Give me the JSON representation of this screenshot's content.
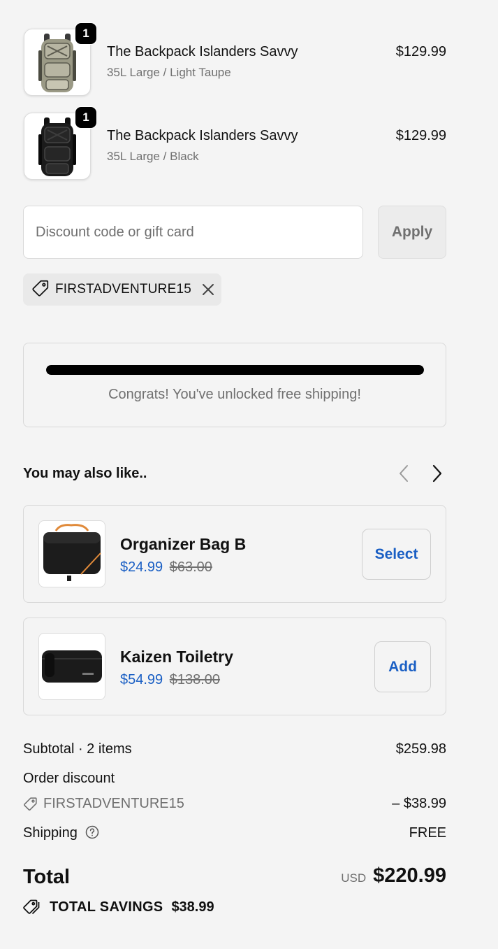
{
  "line_items": [
    {
      "quantity": "1",
      "title": "The Backpack Islanders Savvy",
      "variant": "35L Large / Light Taupe",
      "price": "$129.99"
    },
    {
      "quantity": "1",
      "title": "The Backpack Islanders Savvy",
      "variant": "35L Large / Black",
      "price": "$129.99"
    }
  ],
  "discount": {
    "placeholder": "Discount code or gift card",
    "apply_label": "Apply",
    "applied_code": "FIRSTADVENTURE15"
  },
  "shipping_bar": {
    "progress": 1.0,
    "message": "Congrats! You've unlocked free shipping!"
  },
  "recommendations": {
    "title": "You may also like..",
    "items": [
      {
        "name": "Organizer Bag B",
        "sale_price": "$24.99",
        "compare_price": "$63.00",
        "button_label": "Select"
      },
      {
        "name": "Kaizen Toiletry",
        "sale_price": "$54.99",
        "compare_price": "$138.00",
        "button_label": "Add"
      }
    ]
  },
  "summary": {
    "subtotal_label": "Subtotal · 2 items",
    "subtotal_value": "$259.98",
    "order_discount_label": "Order discount",
    "discount_code": "FIRSTADVENTURE15",
    "discount_value": "– $38.99",
    "shipping_label": "Shipping",
    "shipping_value": "FREE",
    "total_label": "Total",
    "currency": "USD",
    "total_value": "$220.99",
    "savings_label": "TOTAL SAVINGS",
    "savings_value": "$38.99"
  },
  "icons": {
    "tag": "tag-icon",
    "close": "close-icon",
    "help": "help-circle-icon",
    "prev": "chevron-left-icon",
    "next": "chevron-right-icon"
  },
  "colors": {
    "accent_blue": "#1a5fc4",
    "muted_text": "#707070",
    "badge": "#000000",
    "background": "#f4f4f4"
  }
}
